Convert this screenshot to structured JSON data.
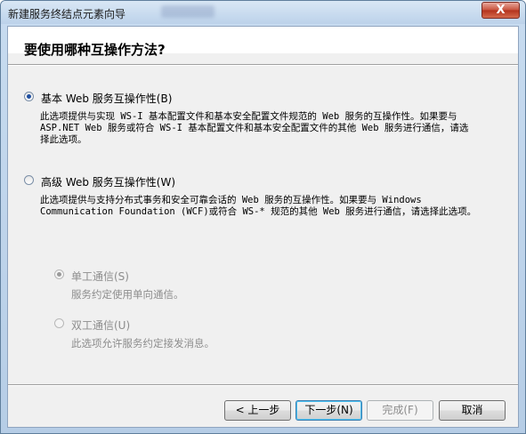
{
  "window": {
    "title": "新建服务终结点元素向导",
    "close_label": "X"
  },
  "header": {
    "title": "要使用哪种互操作方法?"
  },
  "options": {
    "basic": {
      "label": "基本 Web 服务互操作性(B)",
      "checked": true,
      "desc_line1": "此选项提供与实现 WS-I 基本配置文件和基本安全配置文件规范的 Web 服务的互操作性。如果要与",
      "desc_line2": "ASP.NET Web 服务或符合 WS-I 基本配置文件和基本安全配置文件的其他 Web 服务进行通信，请选",
      "desc_line3": "择此选项。"
    },
    "advanced": {
      "label": "高级 Web 服务互操作性(W)",
      "checked": false,
      "desc_line1": "此选项提供与支持分布式事务和安全可靠会话的 Web 服务的互操作性。如果要与 Windows",
      "desc_line2": "Communication Foundation (WCF)或符合 WS-* 规范的其他 Web 服务进行通信，请选择此选项。"
    },
    "simplex": {
      "label": "单工通信(S)",
      "checked": true,
      "enabled": false,
      "desc": "服务约定使用单向通信。"
    },
    "duplex": {
      "label": "双工通信(U)",
      "checked": false,
      "enabled": false,
      "desc": "此选项允许服务约定接发消息。"
    }
  },
  "buttons": {
    "back": "< 上一步",
    "next": "下一步(N)",
    "finish": "完成(F)",
    "cancel": "取消"
  }
}
